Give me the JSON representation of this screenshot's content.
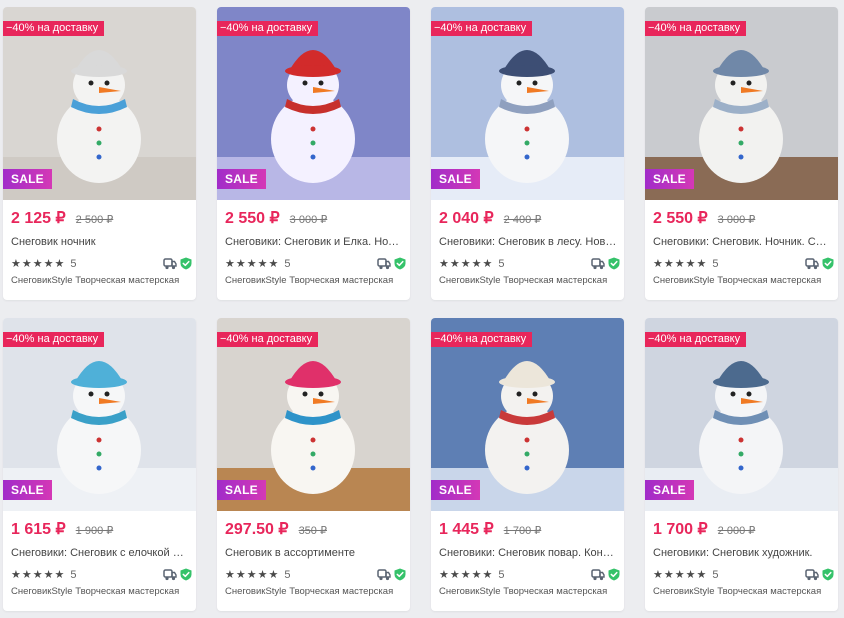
{
  "products": [
    {
      "promo": "−40% на доставку",
      "sale": "SALE",
      "price": "2 125 ₽",
      "old_price": "2 500 ₽",
      "title": "Снеговик ночник",
      "rating": "5",
      "shop": "СнеговикStyle Творческая мастерская",
      "photo": {
        "bg": "#d9d6d2",
        "floor": "#cfcac4",
        "hat": "#d9d9d9",
        "scarf": "#4aa0d8",
        "body": "#f3f3f2"
      }
    },
    {
      "promo": "−40% на доставку",
      "sale": "SALE",
      "price": "2 550 ₽",
      "old_price": "3 000 ₽",
      "title": "Снеговики: Снеговик и Елка. Ноч…",
      "rating": "5",
      "shop": "СнеговикStyle Творческая мастерская",
      "photo": {
        "bg": "#7f86c8",
        "floor": "#b8b7e6",
        "hat": "#d22b2b",
        "scarf": "#c7302c",
        "body": "#f4f1ff"
      }
    },
    {
      "promo": "−40% на доставку",
      "sale": "SALE",
      "price": "2 040 ₽",
      "old_price": "2 400 ₽",
      "title": "Снеговики: Снеговик в лесу. Нов…",
      "rating": "5",
      "shop": "СнеговикStyle Творческая мастерская",
      "photo": {
        "bg": "#aebfe0",
        "floor": "#e6ecf7",
        "hat": "#3d4e74",
        "scarf": "#8fa0bf",
        "body": "#f5f6f8"
      }
    },
    {
      "promo": "−40% на доставку",
      "sale": "SALE",
      "price": "2 550 ₽",
      "old_price": "3 000 ₽",
      "title": "Снеговики: Снеговик. Ночник. Св…",
      "rating": "5",
      "shop": "СнеговикStyle Творческая мастерская",
      "photo": {
        "bg": "#c9cbcf",
        "floor": "#8a6b55",
        "hat": "#7088a8",
        "scarf": "#9cb0c8",
        "body": "#f2f2f0"
      }
    },
    {
      "promo": "−40% на доставку",
      "sale": "SALE",
      "price": "1 615 ₽",
      "old_price": "1 900 ₽",
      "title": "Снеговики: Снеговик с елочкой и …",
      "rating": "5",
      "shop": "СнеговикStyle Творческая мастерская",
      "photo": {
        "bg": "#dfe3ea",
        "floor": "#eef1f5",
        "hat": "#4fb0d8",
        "scarf": "#3aa0c8",
        "body": "#f6f7f8"
      }
    },
    {
      "promo": "−40% на доставку",
      "sale": "SALE",
      "price": "297.50 ₽",
      "old_price": "350 ₽",
      "title": "Снеговик в ассортименте",
      "rating": "5",
      "shop": "СнеговикStyle Творческая мастерская",
      "photo": {
        "bg": "#d8d4cf",
        "floor": "#b98652",
        "hat": "#e0306a",
        "scarf": "#2e93c9",
        "body": "#f8f6f2"
      }
    },
    {
      "promo": "−40% на доставку",
      "sale": "SALE",
      "price": "1 445 ₽",
      "old_price": "1 700 ₽",
      "title": "Снеговики: Снеговик повар. Конд…",
      "rating": "5",
      "shop": "СнеговикStyle Творческая мастерская",
      "photo": {
        "bg": "#5e7fb4",
        "floor": "#c9d6ea",
        "hat": "#ece6da",
        "scarf": "#c93a3a",
        "body": "#f3f2f0"
      }
    },
    {
      "promo": "−40% на доставку",
      "sale": "SALE",
      "price": "1 700 ₽",
      "old_price": "2 000 ₽",
      "title": "Снеговики: Снеговик художник.",
      "rating": "5",
      "shop": "СнеговикStyle Творческая мастерская",
      "photo": {
        "bg": "#cfd5e0",
        "floor": "#e9edf3",
        "hat": "#4c6a8e",
        "scarf": "#6f8fb5",
        "body": "#f4f5f7"
      }
    }
  ],
  "colors": {
    "accent": "#e8265b",
    "sale_start": "#a12cc9",
    "sale_end": "#d438b6",
    "verified": "#35c26a"
  }
}
